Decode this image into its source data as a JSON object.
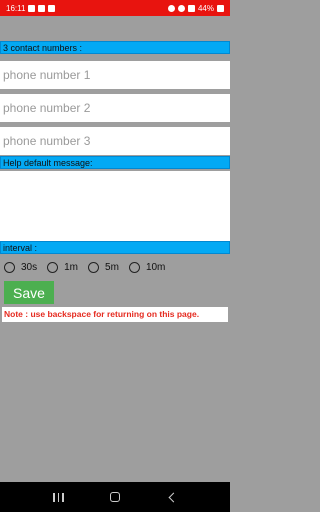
{
  "status_bar": {
    "time": "16:11",
    "battery": "44%",
    "background_color": "#e8140f"
  },
  "contacts": {
    "section_label": "3 contact numbers :",
    "phone1_placeholder": "phone number 1",
    "phone2_placeholder": "phone number 2",
    "phone3_placeholder": "phone number 3"
  },
  "message": {
    "section_label": "Help default message:",
    "value": ""
  },
  "interval": {
    "section_label": "interval :",
    "options": [
      "30s",
      "1m",
      "5m",
      "10m"
    ]
  },
  "save_button": {
    "label": "Save",
    "color": "#4caf50"
  },
  "note": "Note :  use backspace for returning on this page.",
  "colors": {
    "section_label_bg": "#03a9f4",
    "page_bg": "#9e9e9e",
    "note_text": "#e52b20"
  },
  "icons": {
    "status_left": [
      "gallery-icon",
      "message-icon",
      "gmail-icon"
    ],
    "status_right": [
      "location-icon",
      "wifi-icon",
      "signal-icon",
      "battery-icon"
    ],
    "nav": [
      "recents-icon",
      "home-icon",
      "back-icon"
    ]
  }
}
